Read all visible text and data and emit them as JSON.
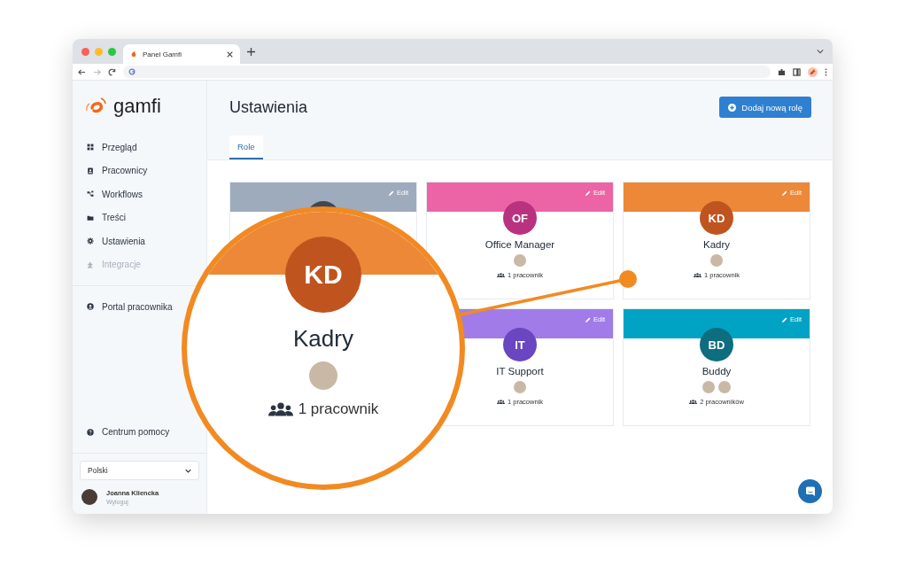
{
  "browser": {
    "tab_title": "Panel Gamfi"
  },
  "sidebar": {
    "logo": "gamfi",
    "nav": [
      {
        "label": "Przegląd",
        "disabled": false
      },
      {
        "label": "Pracownicy",
        "disabled": false
      },
      {
        "label": "Workflows",
        "disabled": false
      },
      {
        "label": "Treści",
        "disabled": false
      },
      {
        "label": "Ustawienia",
        "disabled": false
      },
      {
        "label": "Integracje",
        "disabled": true
      }
    ],
    "portal_link": "Portal pracownika",
    "help_link": "Centrum pomocy",
    "language": "Polski",
    "user": {
      "name": "Joanna Kliencka",
      "action": "Wyloguj"
    }
  },
  "header": {
    "title": "Ustawienia",
    "add_button": "Dodaj nową rolę",
    "tabs": [
      {
        "label": "Role",
        "selected": true
      }
    ]
  },
  "roles": [
    {
      "color": "#9eabbd",
      "avatar": {
        "color": "#3f4754"
      },
      "edit": "Edit"
    },
    {
      "color": "#ec64a5",
      "avatar": {
        "color": "#b8327f",
        "initials": "OF"
      },
      "edit": "Edit",
      "name": "Office Manager",
      "members": [
        {
          "kind": "photo"
        }
      ],
      "count": "1 pracownik"
    },
    {
      "color": "#ec8838",
      "avatar": {
        "color": "#c0541f",
        "initials": "KD"
      },
      "edit": "Edit",
      "name": "Kadry",
      "members": [
        {
          "kind": "photo"
        }
      ],
      "count": "1 pracownik"
    },
    {
      "color": "#a17ce8",
      "avatar": {
        "color": "#6a46c0",
        "initials": "IT"
      },
      "edit": "Edit",
      "name": "IT Support",
      "members": [
        {
          "kind": "photo"
        }
      ],
      "count": "1 pracownik"
    },
    {
      "color": "#00a3c4",
      "avatar": {
        "color": "#0d6e80",
        "initials": "BD"
      },
      "edit": "Edit",
      "name": "Buddy",
      "members": [
        {
          "kind": "photo"
        },
        {
          "kind": "photo"
        }
      ],
      "count": "2 pracowników"
    }
  ],
  "magnifier": {
    "color": "#ec8838",
    "avatar": {
      "color": "#c0541f",
      "initials": "KD"
    },
    "name": "Kadry",
    "members": [
      {
        "kind": "photo"
      }
    ],
    "count": "1 pracownik"
  }
}
